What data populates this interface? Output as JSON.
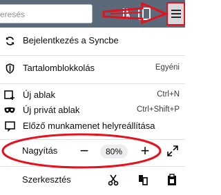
{
  "toolbar": {
    "url_text": "eresés",
    "icons": [
      "library-icon",
      "sidebar-icon",
      "hamburger-menu-icon"
    ]
  },
  "menu": {
    "sync": {
      "label": "Bejelentkezés a Syncbe",
      "icon": "sync-icon"
    },
    "content_blocking": {
      "label": "Tartalomblokkolás",
      "value": "Egyéni",
      "icon": "shield-icon"
    },
    "new_window": {
      "label": "Új ablak",
      "shortcut": "Ctrl+N",
      "icon": "new-window-icon"
    },
    "private_window": {
      "label": "Új privát ablak",
      "shortcut": "Ctrl+Shift+P",
      "icon": "mask-icon"
    },
    "restore_session": {
      "label": "Előző munkamenet helyreállítása",
      "icon": "restore-session-icon"
    },
    "zoom": {
      "label": "Nagyítás",
      "minus": "−",
      "value": "80%",
      "plus": "+",
      "fullscreen_icon": "fullscreen-icon"
    },
    "edit": {
      "label": "Szerkesztés",
      "icons": [
        "cut-icon",
        "copy-icon",
        "paste-icon"
      ]
    }
  },
  "annotations": {
    "color": "#e8101b"
  }
}
